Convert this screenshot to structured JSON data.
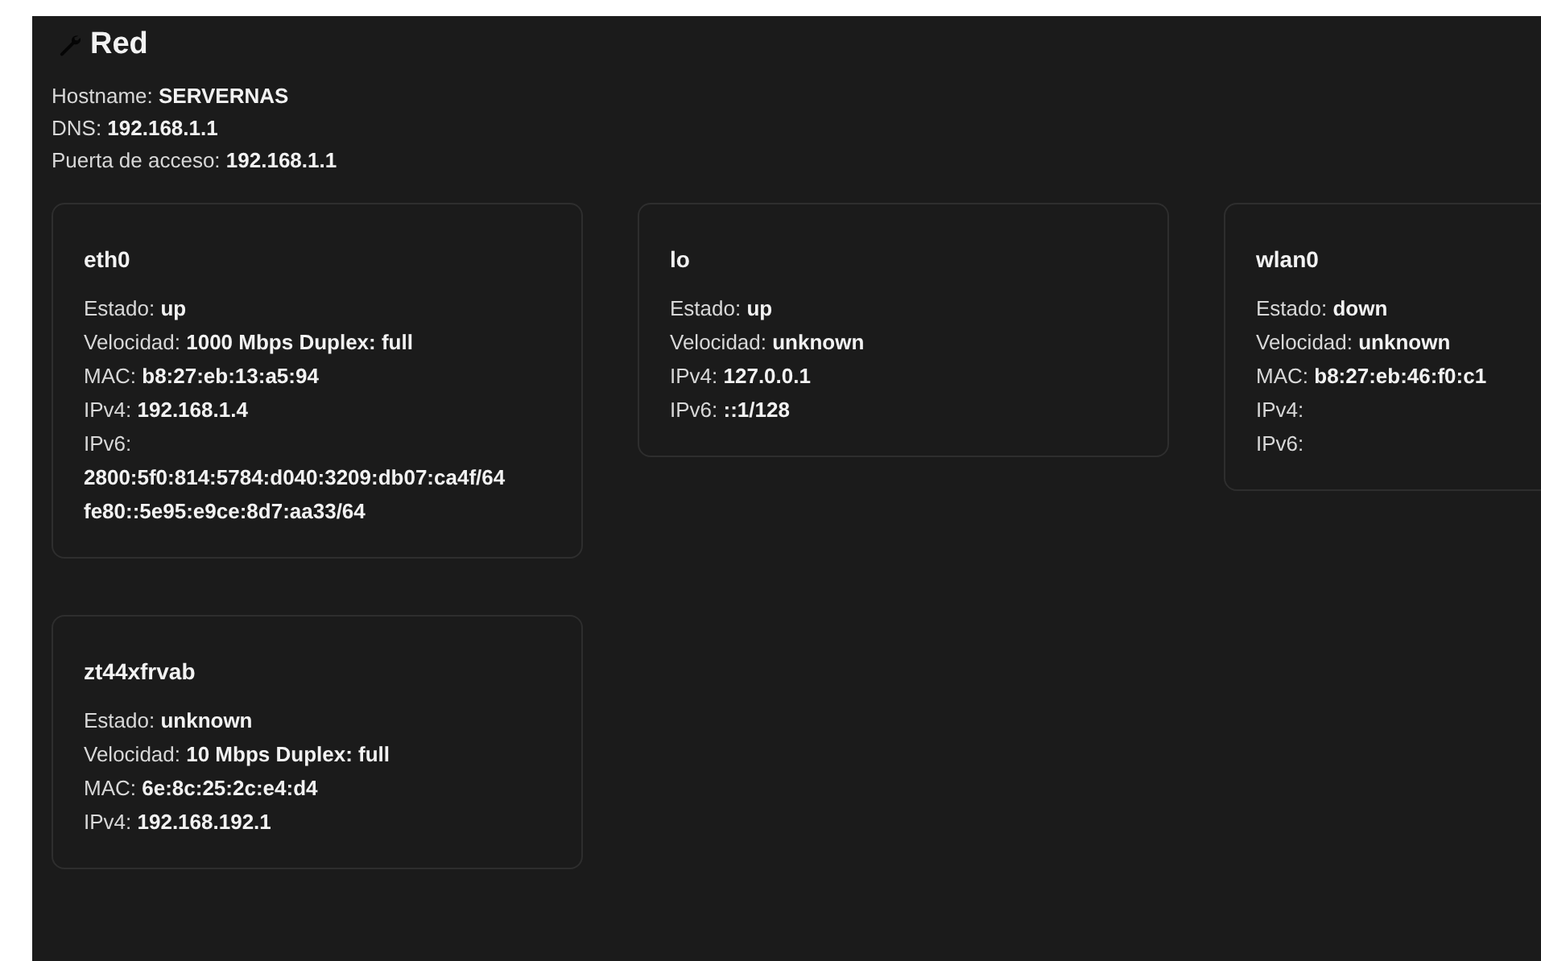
{
  "section": {
    "title": "Red"
  },
  "summary": [
    "Hostname: **SERVERNAS**",
    "DNS: **192.168.1.1**",
    "Puerta de acceso: **192.168.1.1**"
  ],
  "interfaces": [
    {
      "name": "eth0",
      "lines": [
        {
          "kind": "field",
          "text": "Estado: **up**"
        },
        {
          "kind": "field",
          "text": "Velocidad: **1000 Mbps Duplex: full**"
        },
        {
          "kind": "field",
          "text": "MAC: **b8:27:eb:13:a5:94**"
        },
        {
          "kind": "field",
          "text": "IPv4: **192.168.1.4**"
        },
        {
          "kind": "field",
          "text": "IPv6:"
        },
        {
          "kind": "address",
          "text": "2800:5f0:814:5784:d040:3209:db07:ca4f/64"
        },
        {
          "kind": "address",
          "text": "fe80::5e95:e9ce:8d7:aa33/64"
        }
      ]
    },
    {
      "name": "lo",
      "lines": [
        {
          "kind": "field",
          "text": "Estado: **up**"
        },
        {
          "kind": "field",
          "text": "Velocidad: **unknown**"
        },
        {
          "kind": "field",
          "text": "IPv4: **127.0.0.1**"
        },
        {
          "kind": "field",
          "text": "IPv6: **::1/128**"
        }
      ]
    },
    {
      "name": "wlan0",
      "lines": [
        {
          "kind": "field",
          "text": "Estado: **down**"
        },
        {
          "kind": "field",
          "text": "Velocidad: **unknown**"
        },
        {
          "kind": "field",
          "text": "MAC: **b8:27:eb:46:f0:c1**"
        },
        {
          "kind": "field",
          "text": "IPv4:"
        },
        {
          "kind": "field",
          "text": "IPv6:"
        }
      ]
    },
    {
      "name": "zt44xfrvab",
      "lines": [
        {
          "kind": "field",
          "text": "Estado: **unknown**"
        },
        {
          "kind": "field",
          "text": "Velocidad: **10 Mbps Duplex: full**"
        },
        {
          "kind": "field",
          "text": "MAC: **6e:8c:25:2c:e4:d4**"
        },
        {
          "kind": "field",
          "text": "IPv4: **192.168.192.1**"
        }
      ]
    }
  ]
}
